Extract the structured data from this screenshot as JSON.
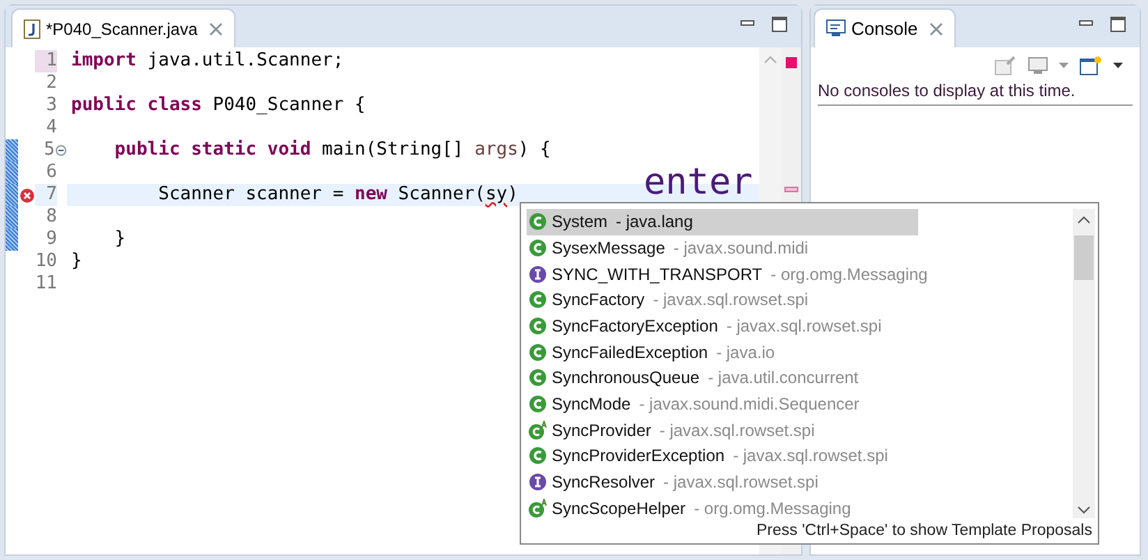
{
  "editor": {
    "tab": {
      "title": "*P040_Scanner.java",
      "selected": true
    },
    "lines": [
      {
        "number": "1",
        "error": false,
        "current": false,
        "changed": false,
        "fold": false,
        "tokens": [
          {
            "kind": "keyword",
            "text": "import "
          },
          {
            "kind": "plain",
            "text": "java.util.Scanner;"
          }
        ]
      },
      {
        "number": "2",
        "error": false,
        "current": false,
        "changed": false,
        "fold": false
      },
      {
        "number": "3",
        "error": false,
        "current": false,
        "changed": false,
        "fold": false,
        "tokens": [
          {
            "kind": "keyword",
            "text": "public class "
          },
          {
            "kind": "plain",
            "text": "P040_Scanner {"
          }
        ]
      },
      {
        "number": "4",
        "error": false,
        "current": false,
        "changed": false,
        "fold": false
      },
      {
        "number": "5",
        "error": false,
        "current": false,
        "changed": true,
        "fold": true,
        "tokens": [
          {
            "kind": "keyword",
            "text": "    public static void "
          },
          {
            "kind": "plain",
            "text": "main(String[] "
          },
          {
            "kind": "param",
            "text": "args"
          },
          {
            "kind": "plain",
            "text": ") {"
          }
        ]
      },
      {
        "number": "6",
        "error": false,
        "current": false,
        "changed": true,
        "fold": false
      },
      {
        "number": "7",
        "error": true,
        "current": true,
        "changed": true,
        "fold": false,
        "tokens": [
          {
            "kind": "plain",
            "text": "        Scanner scanner = "
          },
          {
            "kind": "keyword",
            "text": "new"
          },
          {
            "kind": "plain",
            "text": " Scanner("
          },
          {
            "kind": "squiggle",
            "text": "sy"
          },
          {
            "kind": "plain",
            "text": ")"
          }
        ]
      },
      {
        "number": "8",
        "error": false,
        "current": false,
        "changed": true,
        "fold": false
      },
      {
        "number": "9",
        "error": false,
        "current": false,
        "changed": true,
        "fold": false,
        "tokens": [
          {
            "kind": "plain",
            "text": "    }"
          }
        ]
      },
      {
        "number": "10",
        "error": false,
        "current": false,
        "changed": false,
        "fold": false,
        "tokens": [
          {
            "kind": "plain",
            "text": "}"
          }
        ]
      },
      {
        "number": "11",
        "error": false,
        "current": false,
        "changed": false,
        "fold": false
      }
    ],
    "annotation": "enter"
  },
  "proposals": {
    "items": [
      {
        "kind": "class",
        "name": "System",
        "detail": "- java.lang",
        "selected": true
      },
      {
        "kind": "class",
        "name": "SysexMessage",
        "detail": "- javax.sound.midi",
        "selected": false
      },
      {
        "kind": "interface",
        "name": "SYNC_WITH_TRANSPORT",
        "detail": "- org.omg.Messaging",
        "selected": false
      },
      {
        "kind": "class",
        "name": "SyncFactory",
        "detail": "- javax.sql.rowset.spi",
        "selected": false
      },
      {
        "kind": "class",
        "name": "SyncFactoryException",
        "detail": "- javax.sql.rowset.spi",
        "selected": false
      },
      {
        "kind": "class",
        "name": "SyncFailedException",
        "detail": "- java.io",
        "selected": false
      },
      {
        "kind": "class",
        "name": "SynchronousQueue",
        "detail": "- java.util.concurrent",
        "selected": false
      },
      {
        "kind": "class",
        "name": "SyncMode",
        "detail": "- javax.sound.midi.Sequencer",
        "selected": false
      },
      {
        "kind": "abstract",
        "name": "SyncProvider",
        "detail": "- javax.sql.rowset.spi",
        "selected": false
      },
      {
        "kind": "class",
        "name": "SyncProviderException",
        "detail": "- javax.sql.rowset.spi",
        "selected": false
      },
      {
        "kind": "interface",
        "name": "SyncResolver",
        "detail": "- javax.sql.rowset.spi",
        "selected": false
      },
      {
        "kind": "abstract",
        "name": "SyncScopeHelper",
        "detail": "- org.omg.Messaging",
        "selected": false
      }
    ],
    "hint": "Press 'Ctrl+Space' to show Template Proposals"
  },
  "console": {
    "tab": {
      "title": "Console",
      "selected": true
    },
    "message": "No consoles to display at this time."
  }
}
